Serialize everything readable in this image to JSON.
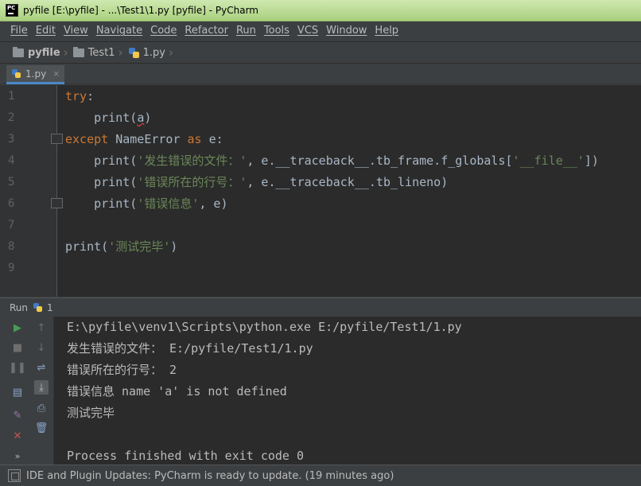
{
  "window": {
    "title": "pyfile [E:\\pyfile] - ...\\Test1\\1.py [pyfile] - PyCharm",
    "app_icon_text": "PC"
  },
  "menu": [
    {
      "label": "File"
    },
    {
      "label": "Edit"
    },
    {
      "label": "View"
    },
    {
      "label": "Navigate"
    },
    {
      "label": "Code"
    },
    {
      "label": "Refactor"
    },
    {
      "label": "Run"
    },
    {
      "label": "Tools"
    },
    {
      "label": "VCS"
    },
    {
      "label": "Window"
    },
    {
      "label": "Help"
    }
  ],
  "breadcrumb": {
    "project": "pyfile",
    "folder": "Test1",
    "file": "1.py"
  },
  "tabs": [
    {
      "label": "1.py",
      "close": "×"
    }
  ],
  "editor": {
    "line_numbers": [
      "1",
      "2",
      "3",
      "4",
      "5",
      "6",
      "7",
      "8",
      "9"
    ],
    "lines": {
      "l1_kw": "try",
      "l1_rest": ":",
      "l2_indent": "    ",
      "l2_fn": "print",
      "l2_open": "(",
      "l2_arg": "a",
      "l2_close": ")",
      "l3_kw": "except",
      "l3_cls": " NameError ",
      "l3_as": "as",
      "l3_rest": " e:",
      "l4_indent": "    ",
      "l4_fn": "print",
      "l4_open": "(",
      "l4_str": "'发生错误的文件：'",
      "l4_mid": ", e.",
      "l4_dunder": "__traceback__",
      "l4_rest": ".tb_frame.f_globals[",
      "l4_str2": "'__file__'",
      "l4_end": "])",
      "l5_indent": "    ",
      "l5_fn": "print",
      "l5_open": "(",
      "l5_str": "'错误所在的行号：'",
      "l5_mid": ", e.",
      "l5_dunder": "__traceback__",
      "l5_end": ".tb_lineno)",
      "l6_indent": "    ",
      "l6_fn": "print",
      "l6_open": "(",
      "l6_str": "'错误信息'",
      "l6_end": ", e)",
      "l8_fn": "print",
      "l8_open": "(",
      "l8_str": "'测试完毕'",
      "l8_end": ")"
    }
  },
  "run": {
    "label": "Run",
    "config_name": "1",
    "output": [
      "E:\\pyfile\\venv1\\Scripts\\python.exe E:/pyfile/Test1/1.py",
      "发生错误的文件： E:/pyfile/Test1/1.py",
      "错误所在的行号： 2",
      "错误信息 name 'a' is not defined",
      "测试完毕",
      "",
      "Process finished with exit code 0"
    ]
  },
  "status": {
    "message": "IDE and Plugin Updates: PyCharm is ready to update. (19 minutes ago)"
  },
  "colors": {
    "keyword": "#cc7832",
    "string": "#6a8759",
    "dunder": "#b200b2",
    "run_green": "#499c54",
    "stop_red": "#c75450"
  }
}
